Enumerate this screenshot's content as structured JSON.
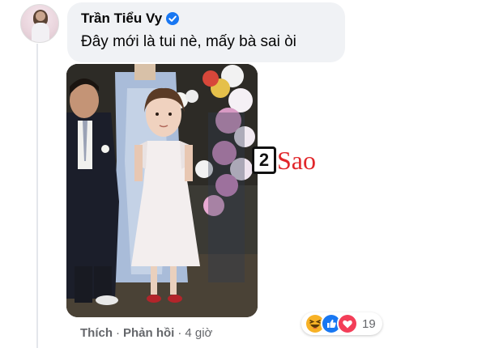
{
  "comment": {
    "author": "Trần Tiểu Vy",
    "text": "Đây mới là tui nè, mấy bà sai òi",
    "verified": true
  },
  "watermark": {
    "number": "2",
    "text": "Sao"
  },
  "actions": {
    "like": "Thích",
    "separator": "·",
    "reply": "Phản hồi",
    "time": "4 giờ"
  },
  "reactions": {
    "icons": [
      "haha-icon",
      "like-icon",
      "love-icon"
    ],
    "count": "19"
  },
  "colors": {
    "bubble": "#f0f2f5",
    "verified": "#1877f2",
    "meta_text": "#65676b",
    "watermark_red": "#e1262a"
  }
}
